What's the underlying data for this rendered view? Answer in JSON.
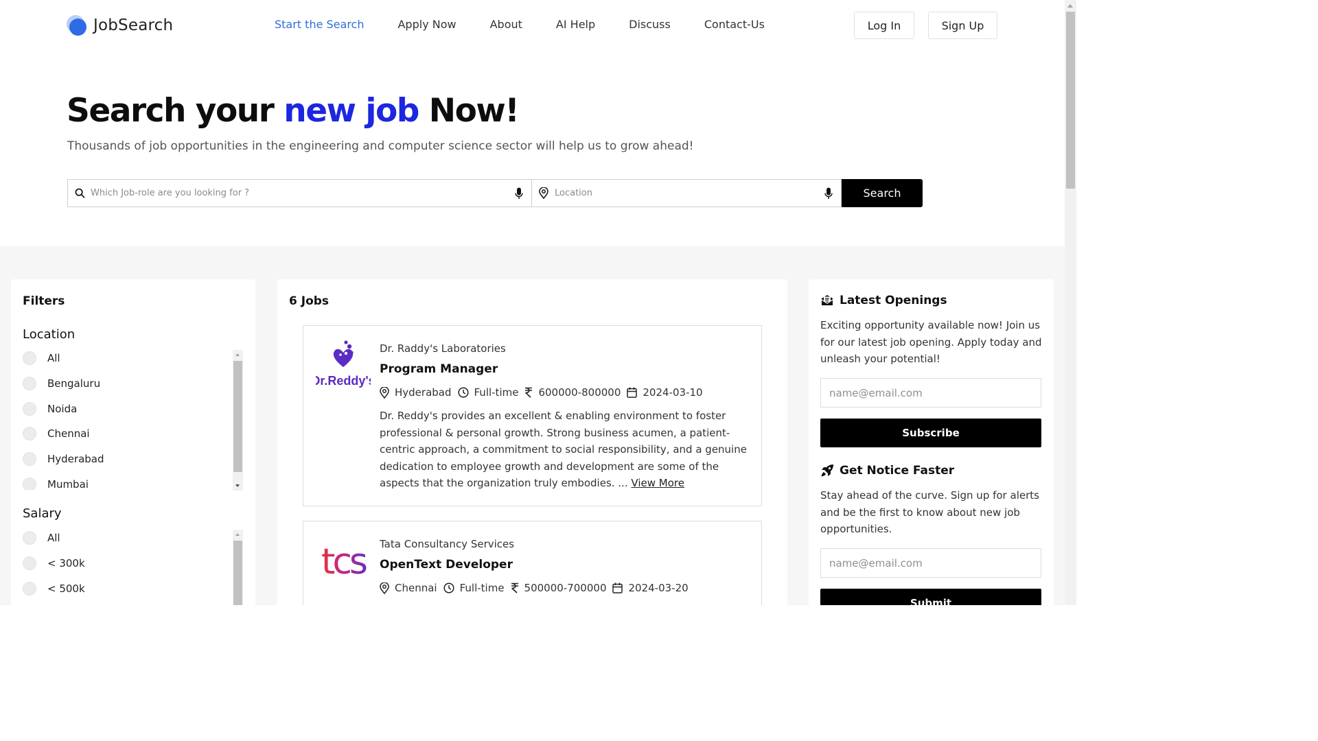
{
  "brand": {
    "name": "JobSearch"
  },
  "nav": {
    "items": [
      {
        "label": "Start the Search",
        "active": true
      },
      {
        "label": "Apply Now"
      },
      {
        "label": "About"
      },
      {
        "label": "AI Help"
      },
      {
        "label": "Discuss"
      },
      {
        "label": "Contact-Us"
      }
    ],
    "login_label": "Log In",
    "signup_label": "Sign Up"
  },
  "hero": {
    "title_part1": "Search your ",
    "title_highlight": "new job",
    "title_part2": " Now!",
    "subtitle": "Thousands of job opportunities in the engineering and computer science sector will help us to grow ahead!"
  },
  "search": {
    "role_placeholder": "Which Job-role are you looking for ?",
    "location_placeholder": "Location",
    "button_label": "Search"
  },
  "filters": {
    "title": "Filters",
    "location": {
      "title": "Location",
      "options": [
        "All",
        "Bengaluru",
        "Noida",
        "Chennai",
        "Hyderabad",
        "Mumbai"
      ]
    },
    "salary": {
      "title": "Salary",
      "options": [
        "All",
        "< 300k",
        "< 500k"
      ]
    }
  },
  "jobs": {
    "count_label": "6 Jobs",
    "items": [
      {
        "company": "Dr. Raddy's Laboratories",
        "title": "Program Manager",
        "location": "Hyderabad",
        "type": "Full-time",
        "salary": "600000-800000",
        "date": "2024-03-10",
        "description": "Dr. Reddy's provides an excellent & enabling environment to foster professional & personal growth. Strong business acumen, a patient-centric approach, a commitment to social responsibility, and a genuine dedication to employee growth and development are some of the aspects that the organization truly embodies. ...",
        "view_more": "View More",
        "logo_text": "Dr.Reddy's"
      },
      {
        "company": "Tata Consultancy Services",
        "title": "OpenText Developer",
        "location": "Chennai",
        "type": "Full-time",
        "salary": "500000-700000",
        "date": "2024-03-20",
        "logo_text": "tcs"
      }
    ]
  },
  "sidebar": {
    "latest": {
      "title": "Latest Openings",
      "text": "Exciting opportunity available now! Join us for our latest job opening. Apply today and unleash your potential!",
      "email_placeholder": "name@email.com",
      "button_label": "Subscribe"
    },
    "notice": {
      "title": "Get Notice Faster",
      "text": "Stay ahead of the curve. Sign up for alerts and be the first to know about new job opportunities.",
      "email_placeholder": "name@email.com",
      "button_label": "Submit"
    }
  },
  "colors": {
    "accent_nav": "#2d6fd9",
    "hero_highlight": "#1d26e0",
    "button_black": "#000000",
    "reddy_purple": "#5b2bc4",
    "tcs_gradient": [
      "#e6323c",
      "#b8268f",
      "#6a2dbb"
    ]
  },
  "icons": [
    "search-icon",
    "mic-icon",
    "location-pin-icon",
    "clock-icon",
    "rupee-icon",
    "calendar-icon",
    "envelope-icon",
    "rocket-icon"
  ]
}
